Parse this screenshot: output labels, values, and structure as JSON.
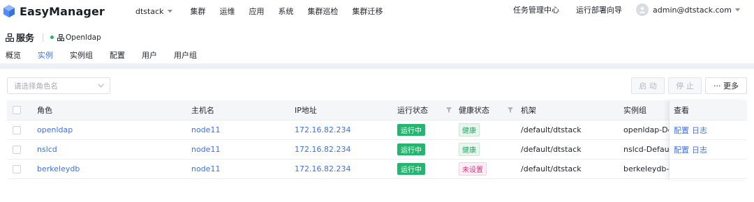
{
  "app": {
    "name": "EasyManager"
  },
  "nav": {
    "env": "dtstack",
    "items": [
      "集群",
      "运维",
      "应用",
      "系统",
      "集群巡检",
      "集群迁移"
    ],
    "right": [
      "任务管理中心",
      "运行部署向导"
    ],
    "user": "admin@dtstack.com"
  },
  "service": {
    "title": "服务",
    "name": "Openldap",
    "status_color": "#23b26d"
  },
  "tabs": [
    {
      "label": "概览"
    },
    {
      "label": "实例",
      "active": true
    },
    {
      "label": "实例组"
    },
    {
      "label": "配置"
    },
    {
      "label": "用户"
    },
    {
      "label": "用户组"
    }
  ],
  "toolbar": {
    "role_placeholder": "请选择角色名",
    "start": "启 动",
    "stop": "停 止",
    "more": "··· 更多"
  },
  "table": {
    "columns": [
      "角色",
      "主机名",
      "IP地址",
      "运行状态",
      "健康状态",
      "机架",
      "实例组",
      "查看"
    ],
    "rows": [
      {
        "role": "openldap",
        "host": "node11",
        "ip": "172.16.82.234",
        "run": "运行中",
        "health": "健康",
        "health_type": "ok",
        "rack": "/default/dtstack",
        "group": "openldap-Def",
        "view1": "配置",
        "view2": "日志"
      },
      {
        "role": "nslcd",
        "host": "node11",
        "ip": "172.16.82.234",
        "run": "运行中",
        "health": "健康",
        "health_type": "ok",
        "rack": "/default/dtstack",
        "group": "nslcd-Default",
        "view1": "配置",
        "view2": "日志"
      },
      {
        "role": "berkeleydb",
        "host": "node11",
        "ip": "172.16.82.234",
        "run": "运行中",
        "health": "未设置",
        "health_type": "unset",
        "rack": "/default/dtstack",
        "group": "berkeleydb-D",
        "view1": "",
        "view2": ""
      }
    ]
  }
}
